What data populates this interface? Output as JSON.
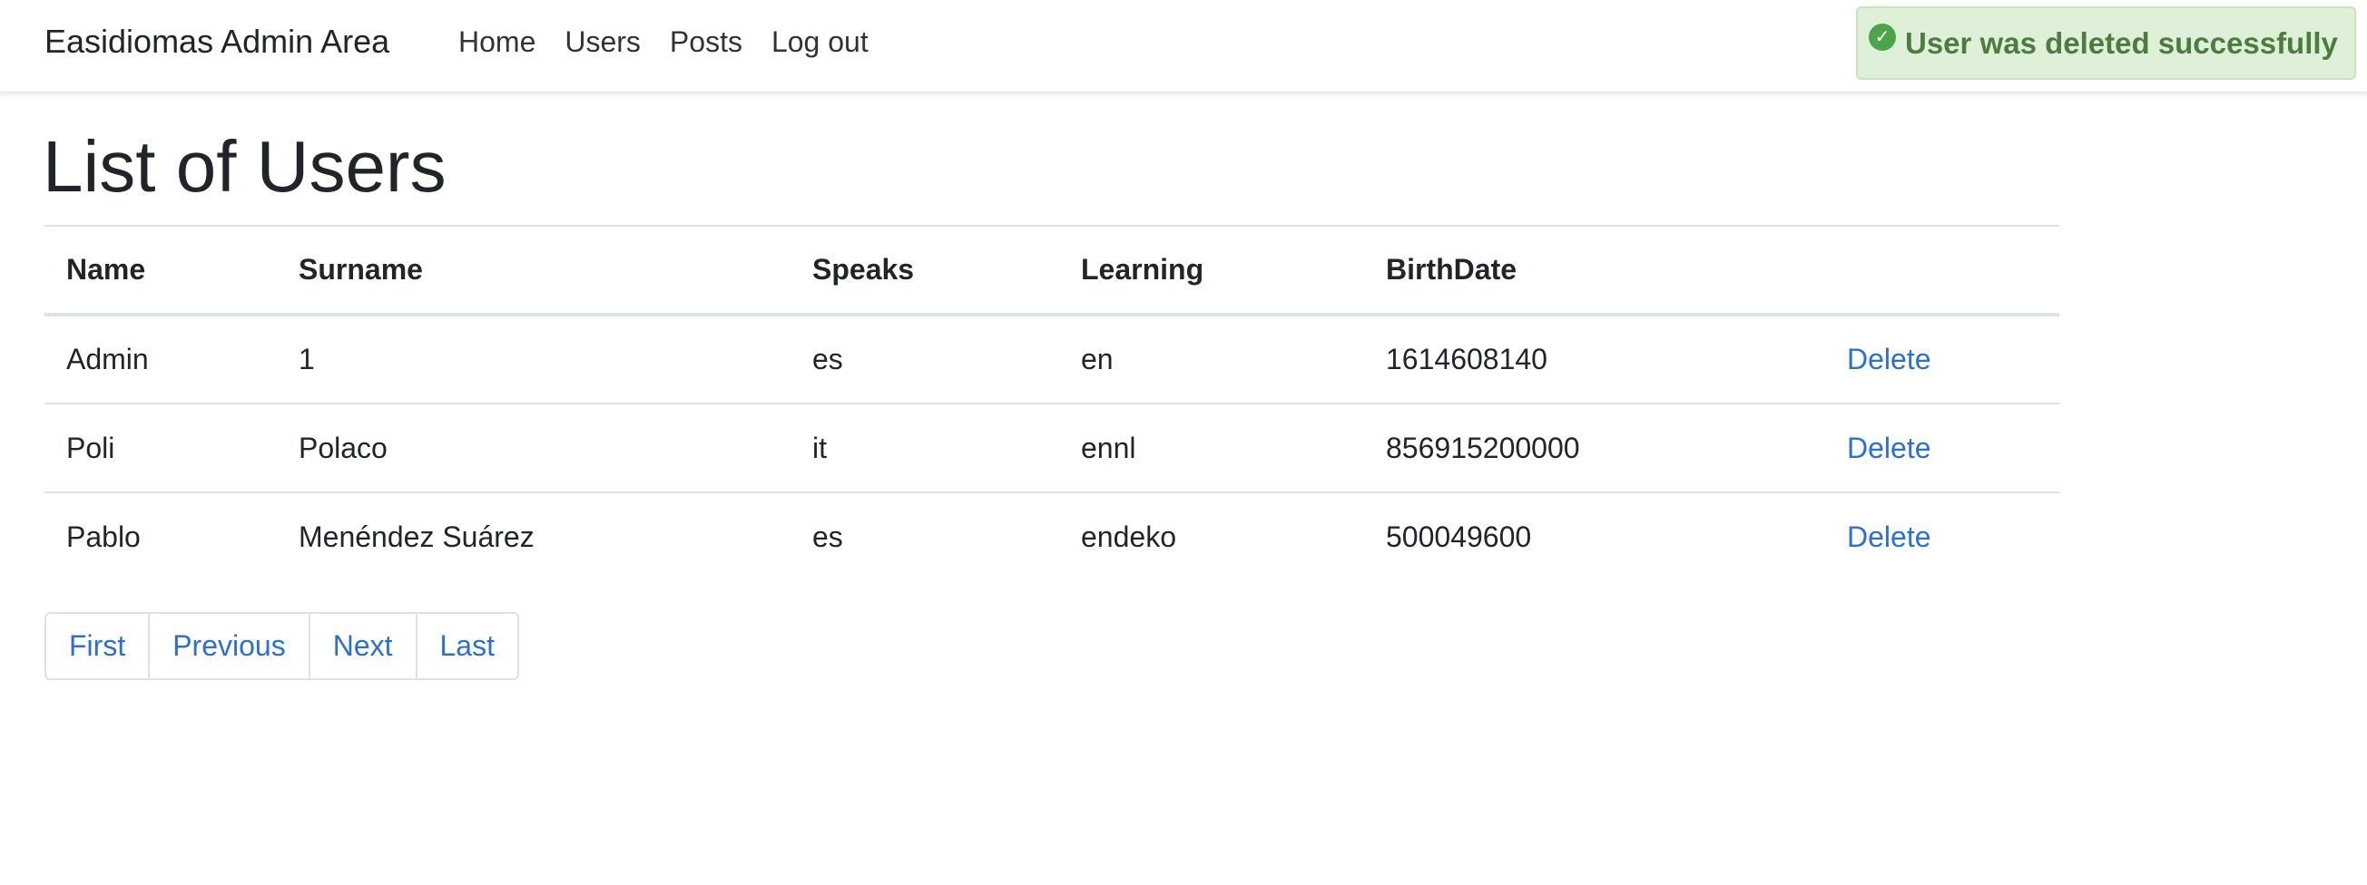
{
  "navbar": {
    "brand": "Easidiomas Admin Area",
    "links": [
      {
        "label": "Home"
      },
      {
        "label": "Users"
      },
      {
        "label": "Posts"
      },
      {
        "label": "Log out"
      }
    ]
  },
  "alert": {
    "icon": "check-circle-icon",
    "message": "User was deleted successfully",
    "color": "#4d7c3f",
    "background": "#dff0d8"
  },
  "page": {
    "title": "List of Users"
  },
  "table": {
    "headers": [
      "Name",
      "Surname",
      "Speaks",
      "Learning",
      "BirthDate",
      ""
    ],
    "rows": [
      {
        "name": "Admin",
        "surname": "1",
        "speaks": "es",
        "learning": "en",
        "birthdate": "1614608140",
        "action": "Delete"
      },
      {
        "name": "Poli",
        "surname": "Polaco",
        "speaks": "it",
        "learning": "ennl",
        "birthdate": "856915200000",
        "action": "Delete"
      },
      {
        "name": "Pablo",
        "surname": "Menéndez Suárez",
        "speaks": "es",
        "learning": "endeko",
        "birthdate": "500049600",
        "action": "Delete"
      }
    ]
  },
  "pagination": {
    "first": "First",
    "previous": "Previous",
    "next": "Next",
    "last": "Last"
  },
  "colors": {
    "link": "#2a6fd6",
    "text": "#212529"
  }
}
